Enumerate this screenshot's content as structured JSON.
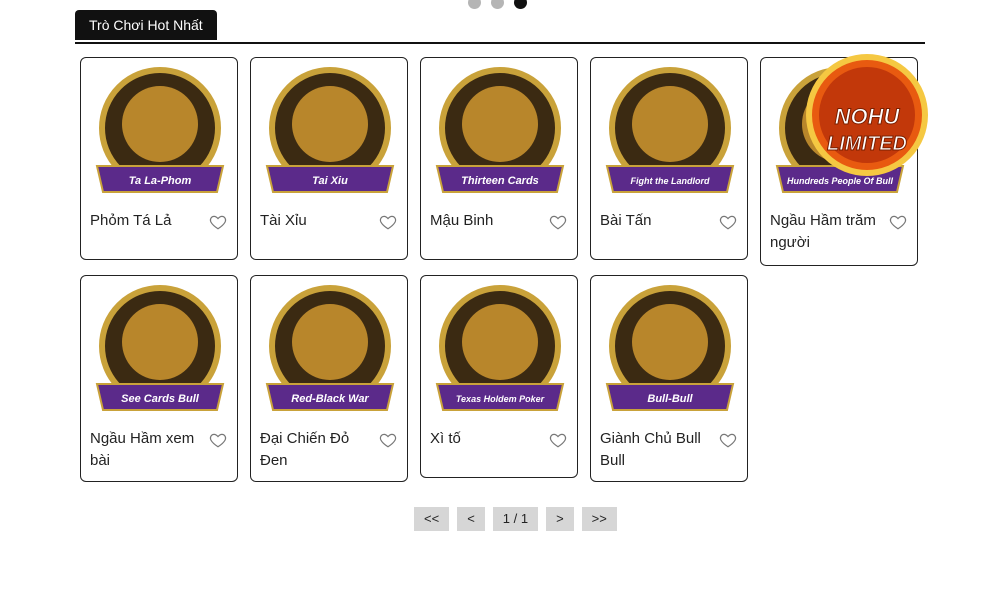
{
  "carousel": {
    "dots": [
      false,
      false,
      true
    ]
  },
  "section": {
    "title": "Trò Chơi Hot Nhất"
  },
  "games": [
    {
      "name": "Phỏm Tá Lả",
      "banner": "Ta La-Phom",
      "icon": "phom-game-icon",
      "color": "#5b2a8a"
    },
    {
      "name": "Tài Xỉu",
      "banner": "Tai Xiu",
      "icon": "tai-xiu-game-icon",
      "color": "#5b2a8a"
    },
    {
      "name": "Mậu Binh",
      "banner": "Thirteen Cards",
      "icon": "mau-binh-game-icon",
      "color": "#5b2a8a"
    },
    {
      "name": "Bài Tấn",
      "banner": "Fight the Landlord",
      "icon": "bai-tan-game-icon",
      "color": "#5b2a8a"
    },
    {
      "name": "Ngầu Hầm trăm người",
      "banner": "Hundreds People Of Bull",
      "icon": "ngau-ham-tram-nguoi-game-icon",
      "color": "#5b2a8a"
    },
    {
      "name": "Ngầu Hầm xem bài",
      "banner": "See Cards Bull",
      "icon": "ngau-ham-xem-bai-game-icon",
      "color": "#5b2a8a"
    },
    {
      "name": "Đại Chiến Đỏ Đen",
      "banner": "Red-Black War",
      "icon": "dai-chien-do-den-game-icon",
      "color": "#5b2a8a"
    },
    {
      "name": "Xì tố",
      "banner": "Texas Holdem Poker",
      "icon": "xi-to-game-icon",
      "color": "#5b2a8a"
    },
    {
      "name": "Giành Chủ Bull Bull",
      "banner": "Bull-Bull",
      "icon": "gianh-chu-bull-bull-game-icon",
      "color": "#5b2a8a"
    }
  ],
  "badge": {
    "line1": "NOHU",
    "line2": "LIMITED"
  },
  "pagination": {
    "first": "<<",
    "prev": "<",
    "page": "1 / 1",
    "next": ">",
    "last": ">>"
  },
  "colors": {
    "accent": "#111111",
    "gold": "#c9a23a",
    "purple": "#5b2a8a",
    "pager_bg": "#d6d6d6"
  }
}
